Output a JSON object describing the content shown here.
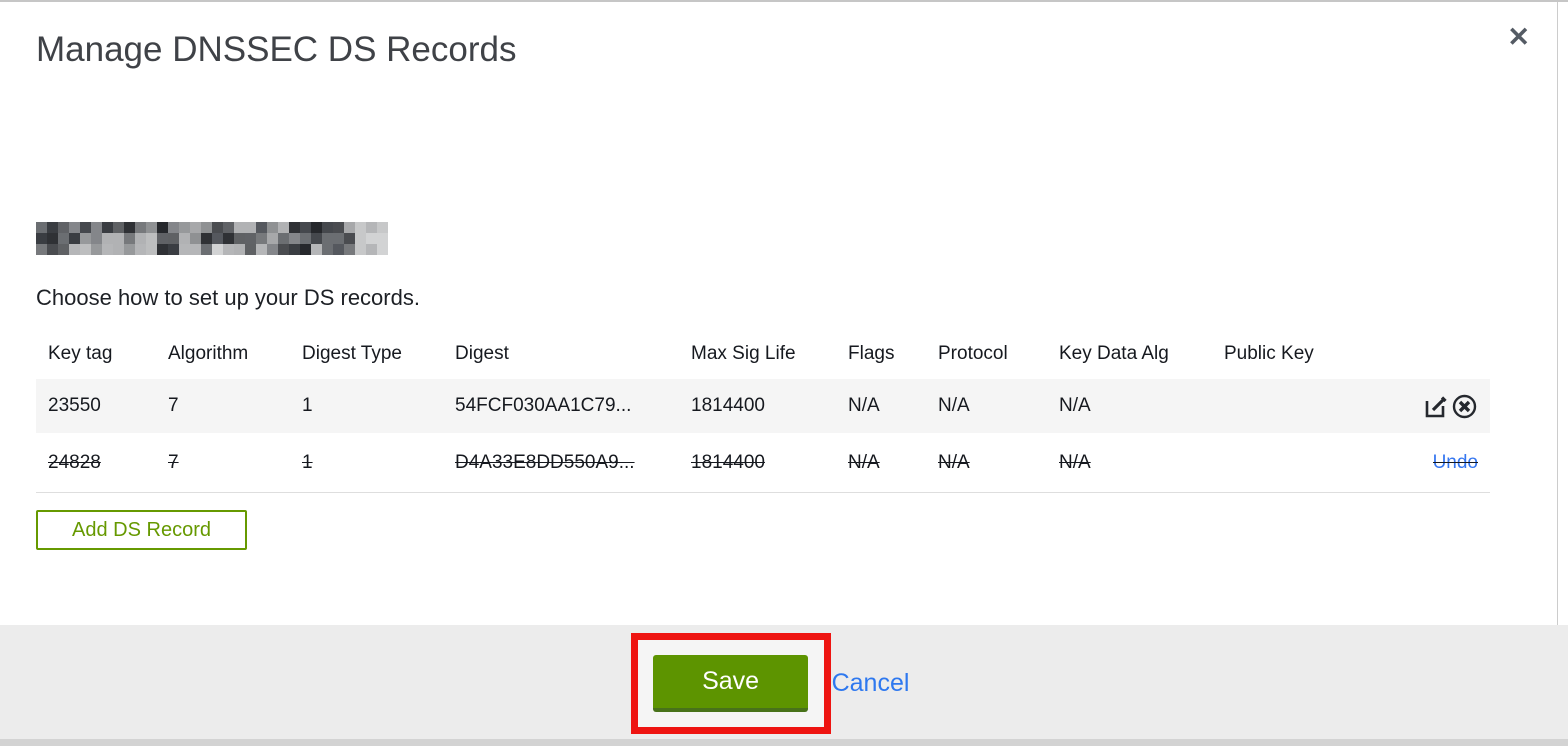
{
  "modal": {
    "title": "Manage DNSSEC DS Records",
    "close_icon": "✕",
    "domain_redacted": true,
    "instruction": "Choose how to set up your DS records."
  },
  "table": {
    "columns": [
      "Key tag",
      "Algorithm",
      "Digest Type",
      "Digest",
      "Max Sig Life",
      "Flags",
      "Protocol",
      "Key Data Alg",
      "Public Key"
    ],
    "rows": [
      {
        "key_tag": "23550",
        "algorithm": "7",
        "digest_type": "1",
        "digest": "54FCF030AA1C79...",
        "max_sig_life": "1814400",
        "flags": "N/A",
        "protocol": "N/A",
        "key_data_alg": "N/A",
        "public_key": "",
        "state": "normal",
        "actions": [
          "edit",
          "delete"
        ]
      },
      {
        "key_tag": "24828",
        "algorithm": "7",
        "digest_type": "1",
        "digest": "D4A33E8DD550A9...",
        "max_sig_life": "1814400",
        "flags": "N/A",
        "protocol": "N/A",
        "key_data_alg": "N/A",
        "public_key": "",
        "state": "deleted",
        "undo_label": "Undo"
      }
    ]
  },
  "buttons": {
    "add_ds_record": "Add DS Record",
    "save": "Save",
    "cancel": "Cancel"
  },
  "colors": {
    "button_green": "#5d9400",
    "outline_green": "#669900",
    "link_blue": "#2e78ef",
    "annotation_red": "#ee1411",
    "row_alt_gray": "#f5f5f5",
    "footer_gray": "#ececec"
  }
}
